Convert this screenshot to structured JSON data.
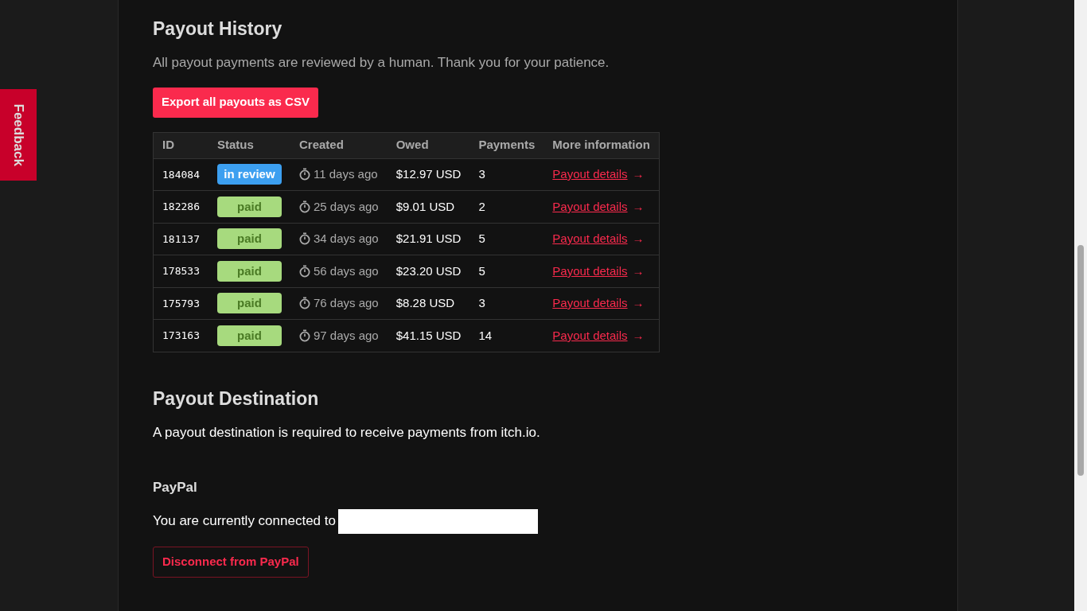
{
  "feedback_tab": {
    "label": "Feedback"
  },
  "payout_history": {
    "title": "Payout History",
    "note": "All payout payments are reviewed by a human. Thank you for your patience.",
    "export_button": "Export all payouts as CSV",
    "table": {
      "columns": [
        "ID",
        "Status",
        "Created",
        "Owed",
        "Payments",
        "More information"
      ],
      "rows": [
        {
          "id": "184084",
          "status": {
            "kind": "review",
            "label": "in review"
          },
          "created": "11 days ago",
          "owed": "$12.97 USD",
          "payments": "3",
          "link": "Payout details",
          "arrow": "→"
        },
        {
          "id": "182286",
          "status": {
            "kind": "paid",
            "label": "paid"
          },
          "created": "25 days ago",
          "owed": "$9.01 USD",
          "payments": "2",
          "link": "Payout details",
          "arrow": "→"
        },
        {
          "id": "181137",
          "status": {
            "kind": "paid",
            "label": "paid"
          },
          "created": "34 days ago",
          "owed": "$21.91 USD",
          "payments": "5",
          "link": "Payout details",
          "arrow": "→"
        },
        {
          "id": "178533",
          "status": {
            "kind": "paid",
            "label": "paid"
          },
          "created": "56 days ago",
          "owed": "$23.20 USD",
          "payments": "5",
          "link": "Payout details",
          "arrow": "→"
        },
        {
          "id": "175793",
          "status": {
            "kind": "paid",
            "label": "paid"
          },
          "created": "76 days ago",
          "owed": "$8.28 USD",
          "payments": "3",
          "link": "Payout details",
          "arrow": "→"
        },
        {
          "id": "173163",
          "status": {
            "kind": "paid",
            "label": "paid"
          },
          "created": "97 days ago",
          "owed": "$41.15 USD",
          "payments": "14",
          "link": "Payout details",
          "arrow": "→"
        }
      ]
    }
  },
  "payout_destination": {
    "title": "Payout Destination",
    "note": "A payout destination is required to receive payments from itch.io.",
    "paypal": {
      "title": "PayPal",
      "connected_text": "You are currently connected to",
      "disconnect_button": "Disconnect from PayPal"
    }
  }
}
